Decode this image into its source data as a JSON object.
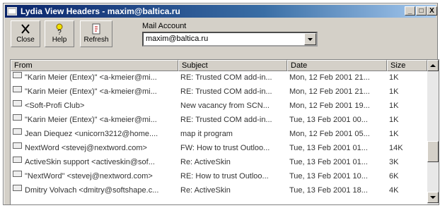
{
  "window": {
    "title": "Lydia   View Headers - maxim@baltica.ru",
    "minimize_label": "_",
    "maximize_label": "□",
    "close_label": "X"
  },
  "toolbar": {
    "close_label": "Close",
    "help_label": "Help",
    "refresh_label": "Refresh"
  },
  "account": {
    "label": "Mail Account",
    "value": "maxim@baltica.ru"
  },
  "columns": [
    "From",
    "Subject",
    "Date",
    "Size"
  ],
  "messages": [
    {
      "from": "\"Karin Meier (Entex)\" <a-kmeier@mi...",
      "subject": "RE: Trusted COM add-in...",
      "date": "Mon, 12 Feb 2001 21...",
      "size": "1K"
    },
    {
      "from": "\"Karin Meier (Entex)\" <a-kmeier@mi...",
      "subject": "RE: Trusted COM add-in...",
      "date": "Mon, 12 Feb 2001 21...",
      "size": "1K"
    },
    {
      "from": "<Soft-Profi Club>",
      "subject": "New vacancy from SCN...",
      "date": "Mon, 12 Feb 2001 19...",
      "size": "1K"
    },
    {
      "from": "\"Karin Meier (Entex)\" <a-kmeier@mi...",
      "subject": "RE: Trusted COM add-in...",
      "date": "Tue, 13 Feb 2001 00...",
      "size": "1K"
    },
    {
      "from": "Jean Diequez <unicorn3212@home....",
      "subject": "map it program",
      "date": "Mon, 12 Feb 2001 05...",
      "size": "1K"
    },
    {
      "from": "NextWord <stevej@nextword.com>",
      "subject": "FW: How to trust Outloo...",
      "date": "Tue, 13 Feb 2001 01...",
      "size": "14K"
    },
    {
      "from": "ActiveSkin support <activeskin@sof...",
      "subject": "Re: ActiveSkin",
      "date": "Tue, 13 Feb 2001 01...",
      "size": "3K"
    },
    {
      "from": "\"NextWord\" <stevej@nextword.com>",
      "subject": "RE: How to trust Outloo...",
      "date": "Tue, 13 Feb 2001 10...",
      "size": "6K"
    },
    {
      "from": "Dmitry Volvach <dmitry@softshape.c...",
      "subject": "Re: ActiveSkin",
      "date": "Tue, 13 Feb 2001 18...",
      "size": "4K"
    }
  ],
  "colors": {
    "title_bar": "#0a246a",
    "face": "#d4d0c8"
  }
}
